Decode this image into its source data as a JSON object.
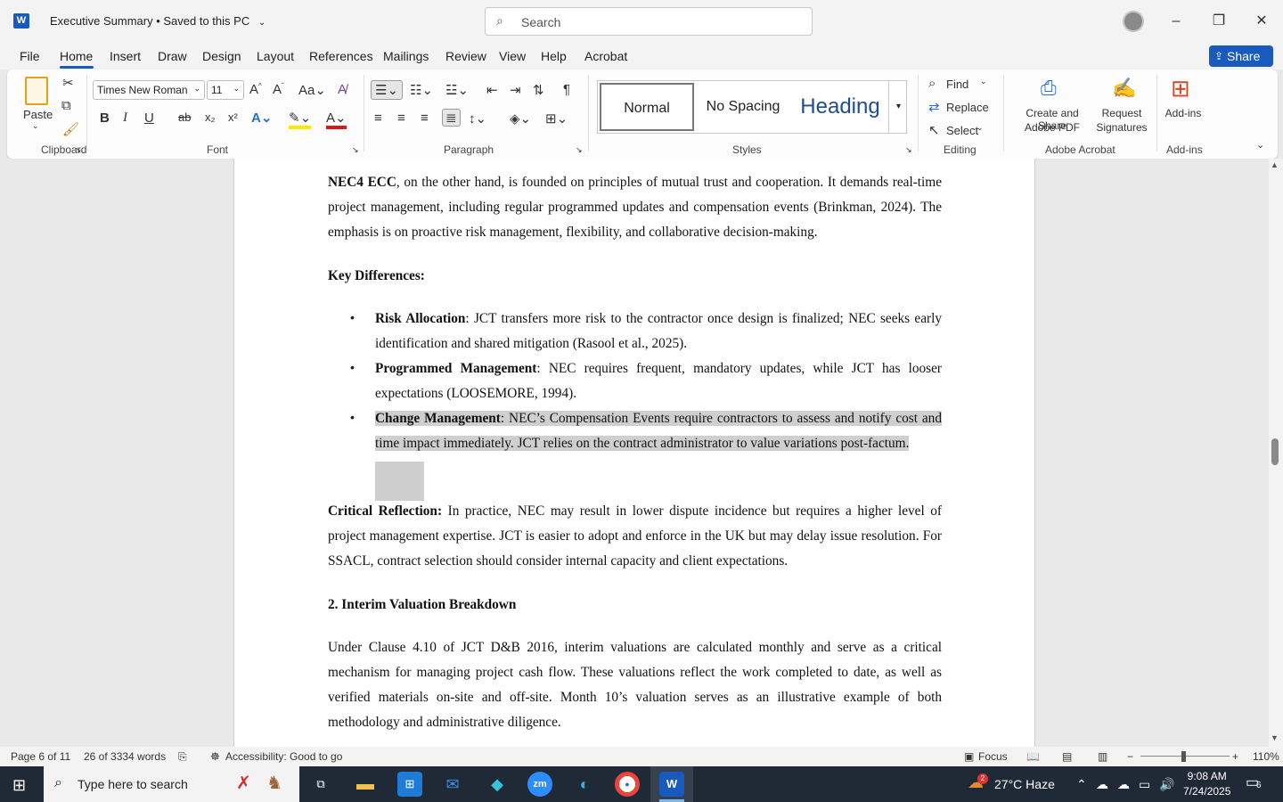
{
  "window": {
    "title": "Executive Summary",
    "save_status": "• Saved to this PC",
    "search_placeholder": "Search"
  },
  "menu": {
    "tabs": [
      "File",
      "Home",
      "Insert",
      "Draw",
      "Design",
      "Layout",
      "References",
      "Mailings",
      "Review",
      "View",
      "Help",
      "Acrobat"
    ],
    "active": "Home",
    "share_label": "Share"
  },
  "ribbon": {
    "clipboard": {
      "paste": "Paste",
      "label": "Clipboard"
    },
    "font": {
      "family": "Times New Roman",
      "size": "11",
      "label": "Font",
      "bold": "B",
      "italic": "I",
      "underline": "U",
      "strike": "ab",
      "sub": "x₂",
      "sup": "x²"
    },
    "paragraph": {
      "label": "Paragraph"
    },
    "styles": {
      "normal": "Normal",
      "no_spacing": "No Spacing",
      "heading": "Heading",
      "label": "Styles"
    },
    "editing": {
      "find": "Find",
      "replace": "Replace",
      "select": "Select",
      "label": "Editing"
    },
    "acrobat": {
      "create_share_1": "Create and Share",
      "create_share_2": "Adobe PDF",
      "request_1": "Request",
      "request_2": "Signatures",
      "label": "Adobe Acrobat"
    },
    "addins": {
      "button": "Add-ins",
      "label": "Add-ins"
    }
  },
  "document": {
    "p1_bold": "NEC4 ECC",
    "p1_rest": ", on the other hand, is founded on principles of mutual trust and cooperation. It demands real-time project management, including regular programmed updates and compensation events (Brinkman, 2024). The emphasis is on proactive risk management, flexibility, and collaborative decision-making.",
    "key_heading": "Key Differences:",
    "bullets": [
      {
        "bold": "Risk Allocation",
        "text": ": JCT transfers more risk to the contractor once design is finalized; NEC seeks early identification and shared mitigation (Rasool et al., 2025)."
      },
      {
        "bold": "Programmed Management",
        "text": ": NEC requires frequent, mandatory updates, while JCT has looser expectations (LOOSEMORE, 1994)."
      },
      {
        "bold": "Change Management",
        "text": ": NEC’s Compensation Events require contractors to assess and notify cost and time impact immediately. JCT relies on the contract administrator to value variations post-factum."
      }
    ],
    "reflection_bold": "Critical Reflection:",
    "reflection_text": " In practice, NEC may result in lower dispute incidence but requires a higher level of project management expertise. JCT is easier to adopt and enforce in the UK but may delay issue resolution. For SSACL, contract selection should consider internal capacity and client expectations.",
    "section2_heading": "2. Interim Valuation Breakdown",
    "section2_text": "Under Clause 4.10 of JCT D&B 2016, interim valuations are calculated monthly and serve as a critical mechanism for managing project cash flow. These valuations reflect the work completed to date, as well as verified materials on-site and off-site. Month 10’s valuation serves as an illustrative example of both methodology and administrative diligence."
  },
  "status": {
    "page": "Page 6 of 11",
    "words": "26 of 3334 words",
    "accessibility": "Accessibility: Good to go",
    "focus": "Focus",
    "zoom": "110%"
  },
  "taskbar": {
    "search_placeholder": "Type here to search",
    "weather": "27°C  Haze",
    "weather_badge": "2",
    "time": "9:08 AM",
    "date": "7/24/2025",
    "notifications": "6"
  }
}
